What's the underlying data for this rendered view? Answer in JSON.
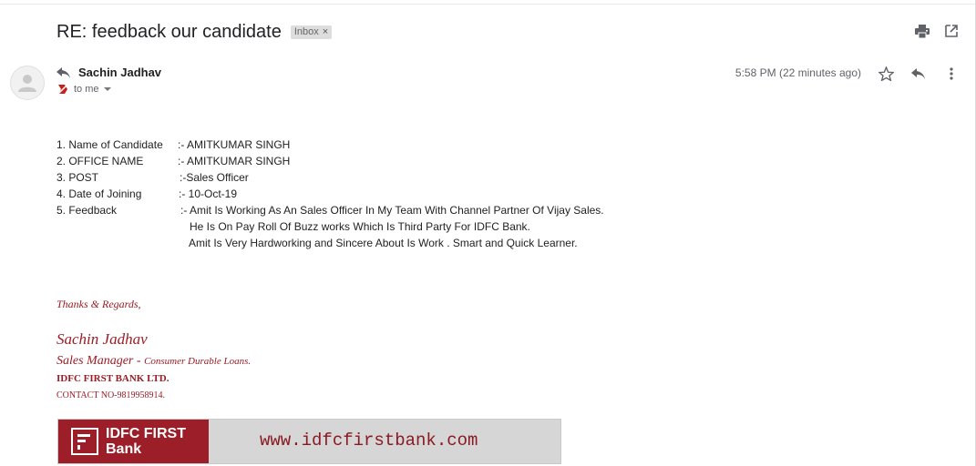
{
  "email": {
    "subject": "RE: feedback our candidate",
    "label_chip": "Inbox",
    "label_chip_close": "×",
    "sender_name": "Sachin Jadhav",
    "to_label": "to me",
    "time": "5:58 PM (22 minutes ago)",
    "icons": {
      "print": "print-icon",
      "open_new_window": "open-in-new-window-icon",
      "star": "star-icon",
      "reply": "reply-icon",
      "more": "more-vert-icon",
      "reply_indicator": "reply-arrow-icon",
      "importance": "importance-marker-icon",
      "avatar": "avatar-icon"
    }
  },
  "body": {
    "rows": [
      {
        "key": "1. Name of Candidate",
        "value": ":- AMITKUMAR SINGH"
      },
      {
        "key": "2. OFFICE NAME",
        "value": ":- AMITKUMAR SINGH"
      },
      {
        "key": "3. POST",
        "value": ":-Sales Officer"
      },
      {
        "key": "4. Date of Joining",
        "value": ":- 10-Oct-19"
      },
      {
        "key": "5. Feedback",
        "value": ":- Amit Is Working As An Sales Officer In My Team With Channel Partner Of Vijay Sales."
      }
    ],
    "feedback_cont_1": "He Is On Pay Roll Of Buzz works Which Is Third Party For IDFC Bank.",
    "feedback_cont_2": "Amit Is Very Hardworking and Sincere About Is Work . Smart and Quick Learner."
  },
  "signature": {
    "thanks": "Thanks & Regards,",
    "name": "Sachin Jadhav",
    "title": "Sales Manager",
    "title_sep": " - ",
    "dept": "Consumer Durable Loans.",
    "company": "IDFC FIRST BANK LTD.",
    "contact": "CONTACT NO-9819958914."
  },
  "banner": {
    "logo_line1": "IDFC FIRST",
    "logo_line2": "Bank",
    "url": "www.idfcfirstbank.com"
  },
  "colors": {
    "signature": "#9b1c24",
    "banner_red": "#9c1e29",
    "banner_grey": "#d6d6d6",
    "icon": "#5f6368"
  }
}
